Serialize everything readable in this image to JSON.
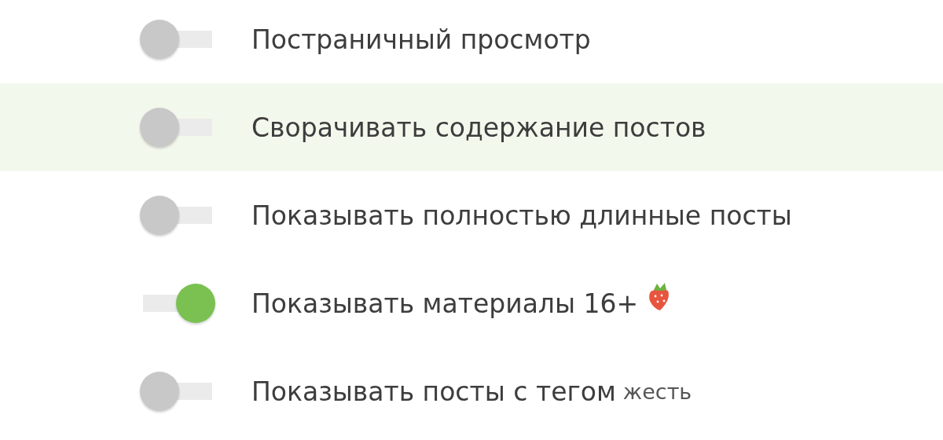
{
  "settings": [
    {
      "label": "Постраничный просмотр",
      "on": false,
      "highlighted": false
    },
    {
      "label": "Сворачивать содержание постов",
      "on": false,
      "highlighted": true
    },
    {
      "label": "Показывать полностью длинные посты",
      "on": false,
      "highlighted": false
    },
    {
      "label": "Показывать материалы 16+",
      "on": true,
      "highlighted": false,
      "icon": true
    },
    {
      "label": "Показывать посты с тегом",
      "on": false,
      "highlighted": false,
      "tag": "жесть"
    }
  ]
}
